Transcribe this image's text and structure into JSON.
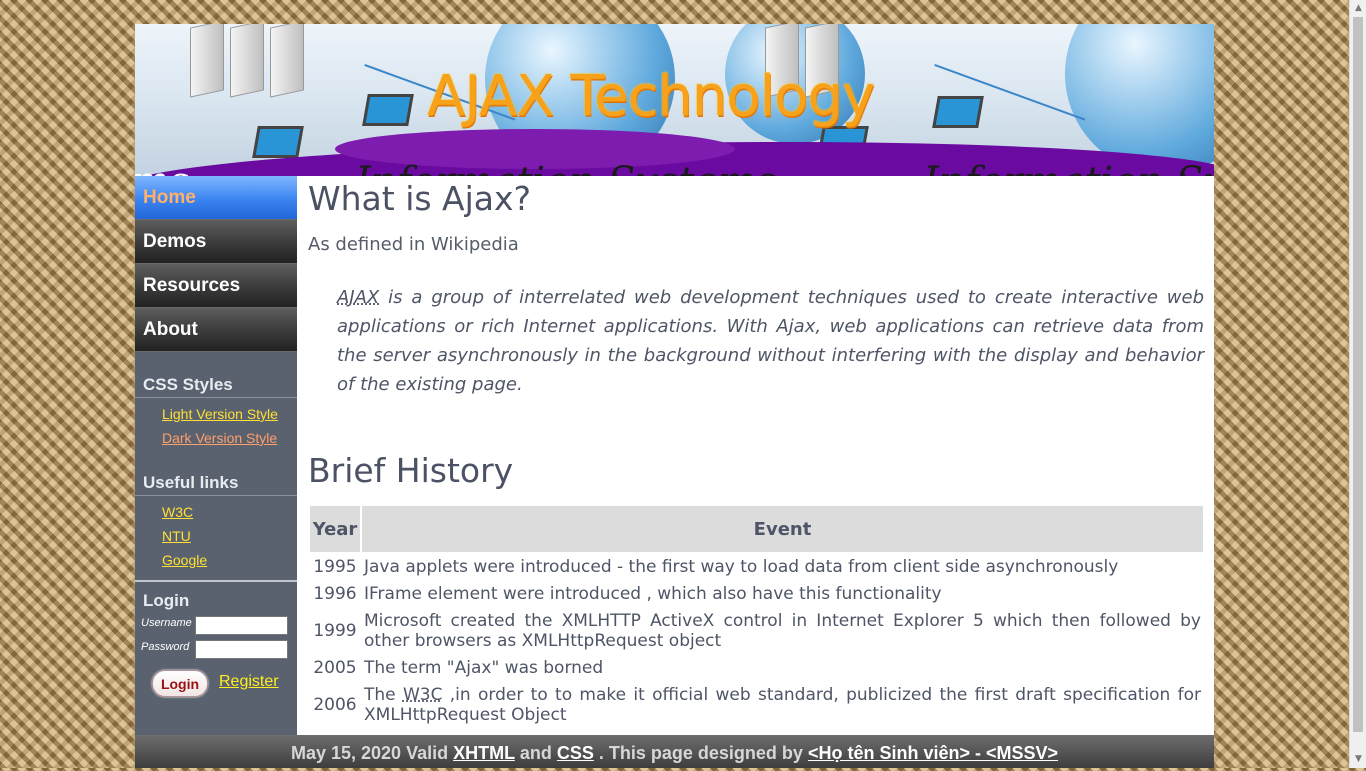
{
  "header": {
    "title": "AJAX Technology",
    "banner_text": "Information Systems"
  },
  "nav": {
    "items": [
      {
        "label": "Home",
        "active": true
      },
      {
        "label": "Demos",
        "active": false
      },
      {
        "label": "Resources",
        "active": false
      },
      {
        "label": "About",
        "active": false
      }
    ]
  },
  "sidebar": {
    "css_styles": {
      "heading": "CSS Styles",
      "links": [
        "Light Version Style",
        "Dark Version Style"
      ]
    },
    "useful_links": {
      "heading": "Useful links",
      "links": [
        "W3C",
        "NTU",
        "Google"
      ]
    },
    "login": {
      "heading": "Login",
      "username_label": "Username",
      "username_value": "",
      "password_label": "Password",
      "password_value": "",
      "login_button": "Login",
      "register_link": "Register"
    }
  },
  "main": {
    "title": "What is Ajax?",
    "subtitle": "As defined in Wikipedia",
    "quote_abbr": "AJAX",
    "quote_text": " is a group of interrelated web development techniques used to create interactive web applications or rich Internet applications. With Ajax, web applications can retrieve data from the server asynchronously in the background without interfering with the display and behavior of the existing page.",
    "history_title": "Brief History",
    "table": {
      "headers": [
        "Year",
        "Event"
      ],
      "rows": [
        {
          "year": "1995",
          "event": "Java applets were introduced - the first way to load data from client side asynchronously"
        },
        {
          "year": "1996",
          "event": "IFrame element were introduced , which also have this functionality"
        },
        {
          "year": "1999",
          "event": "Microsoft created the XMLHTTP ActiveX control in Internet Explorer 5 which then followed by other browsers as XMLHttpRequest object"
        },
        {
          "year": "2005",
          "event": "The term \"Ajax\" was borned"
        },
        {
          "year": "2006",
          "event_prefix": "The ",
          "event_abbr": "W3C",
          "event_suffix": " ,in order to to make it official web standard, publicized the first draft specification for XMLHttpRequest Object"
        }
      ]
    }
  },
  "footer": {
    "date": "May 15, 2020",
    "valid": "Valid",
    "xhtml": "XHTML",
    "and": "and",
    "css": "CSS",
    "designed": ". This page designed by",
    "author": "<Họ tên Sinh viên> - <MSSV>"
  }
}
